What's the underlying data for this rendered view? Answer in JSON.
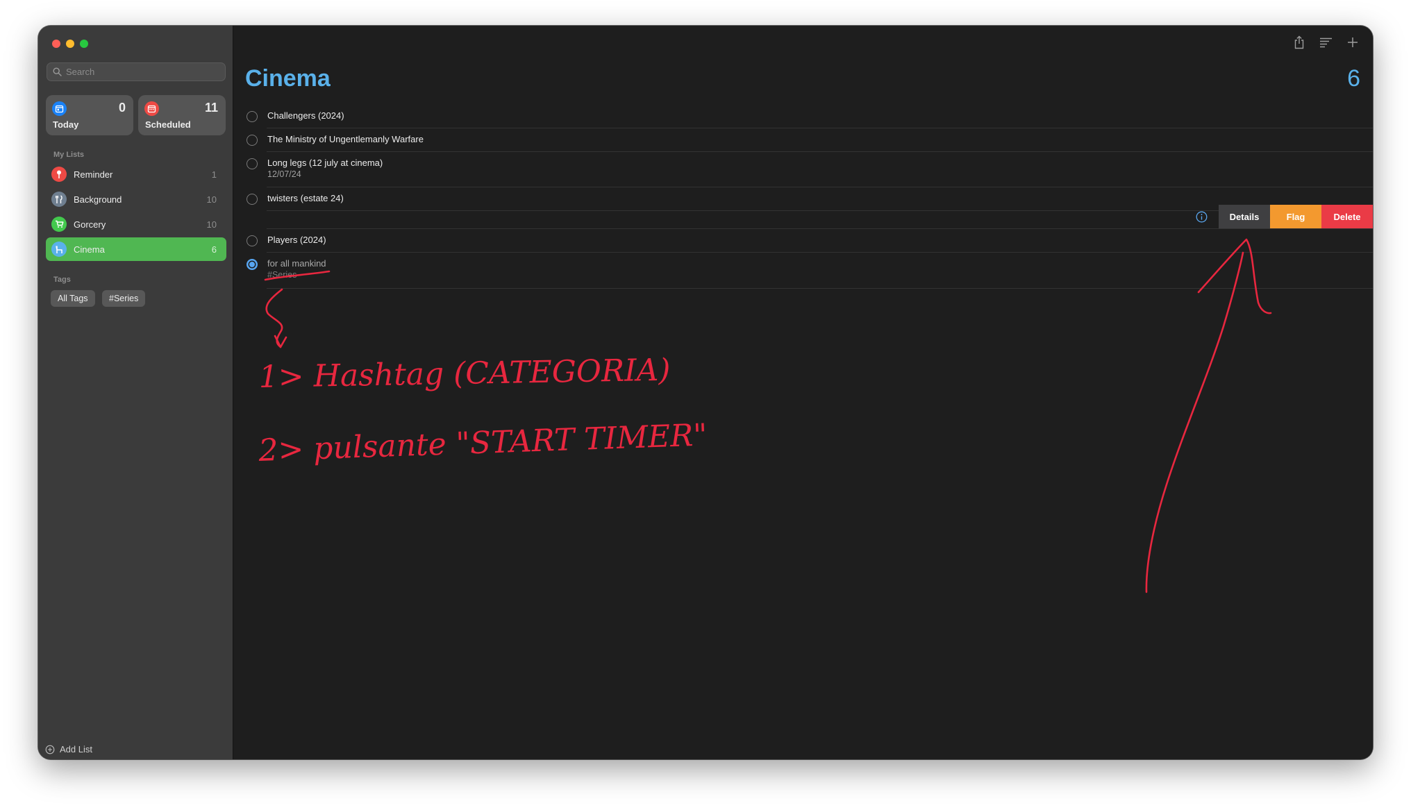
{
  "window": {
    "traffic_lights": [
      "#fe5f57",
      "#febc2e",
      "#28c840"
    ]
  },
  "sidebar": {
    "search": {
      "placeholder": "Search",
      "icon": "search-icon"
    },
    "smart_lists": [
      {
        "label": "Today",
        "count": "0",
        "icon": "calendar-today-icon",
        "color": "#1a82f7"
      },
      {
        "label": "Scheduled",
        "count": "11",
        "icon": "calendar-scheduled-icon",
        "color": "#ee4a45"
      }
    ],
    "my_lists_heading": "My Lists",
    "lists": [
      {
        "name": "Reminder",
        "count": "1",
        "icon": "pushpin-icon",
        "color": "#ee4a45"
      },
      {
        "name": "Background",
        "count": "10",
        "icon": "fork-knife-icon",
        "color": "#6f7f90"
      },
      {
        "name": "Gorcery",
        "count": "10",
        "icon": "cart-icon",
        "color": "#43c94d"
      },
      {
        "name": "Cinema",
        "count": "6",
        "icon": "chair-icon",
        "color": "#5ab1ea",
        "active": true
      }
    ],
    "tags_heading": "Tags",
    "tags": [
      "All Tags",
      "#Series"
    ],
    "add_list": "Add List"
  },
  "toolbar": {
    "icons": [
      "share-icon",
      "view-options-icon",
      "add-icon"
    ]
  },
  "main": {
    "title": "Cinema",
    "count": "6",
    "accent": "#5ab1ea",
    "reminders": [
      {
        "title": "Challengers (2024)"
      },
      {
        "title": "The Ministry of Ungentlemanly Warfare"
      },
      {
        "title": "Long legs (12 july at cinema)",
        "subtitle": "12/07/24"
      },
      {
        "title": "twisters (estate 24)"
      },
      {
        "title": "Players (2024)"
      },
      {
        "title": "for all mankind",
        "tag": "#Series",
        "selected": true
      }
    ],
    "swipe_actions": {
      "info_icon": "info-icon",
      "details": "Details",
      "flag": "Flag",
      "delete": "Delete",
      "colors": {
        "details": "#3f3f41",
        "flag": "#f3992f",
        "delete": "#ea3b46"
      }
    }
  },
  "annotations": {
    "color": "#e8273f",
    "line1": "1> Hashtag (CATEGORIA)",
    "line2": "2> pulsante \"START TIMER\""
  }
}
